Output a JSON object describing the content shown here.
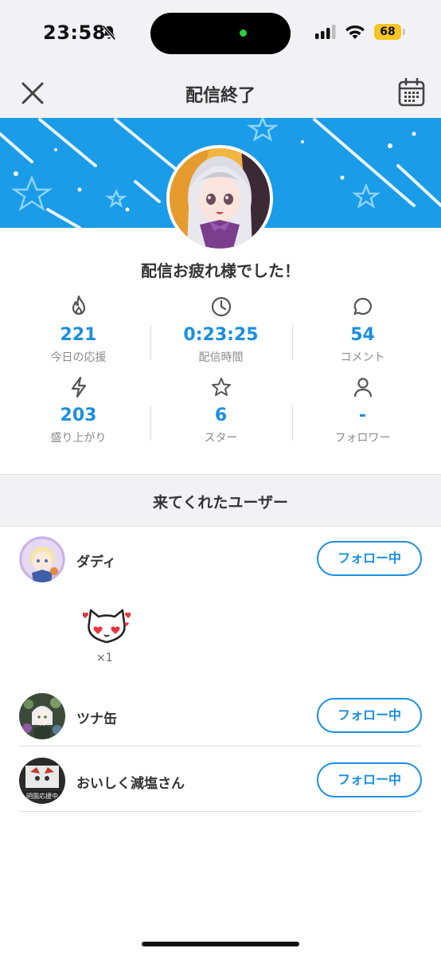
{
  "status_bar": {
    "time": "23:58",
    "battery": "68"
  },
  "nav": {
    "title": "配信終了"
  },
  "thanks_message": "配信お疲れ様でした！",
  "stats": [
    {
      "icon": "flame-icon",
      "value": "221",
      "label": "今日の応援"
    },
    {
      "icon": "clock-icon",
      "value": "0:23:25",
      "label": "配信時間"
    },
    {
      "icon": "comment-icon",
      "value": "54",
      "label": "コメント"
    },
    {
      "icon": "lightning-icon",
      "value": "203",
      "label": "盛り上がり"
    },
    {
      "icon": "star-icon",
      "value": "6",
      "label": "スター"
    },
    {
      "icon": "person-icon",
      "value": "-",
      "label": "フォロワー"
    }
  ],
  "visitors_section": {
    "title": "来てくれたユーザー"
  },
  "users": [
    {
      "name": "ダディ",
      "follow_label": "フォロー中"
    },
    {
      "name": "ツナ缶",
      "follow_label": "フォロー中"
    },
    {
      "name": "おいしく減塩さん",
      "follow_label": "フォロー中"
    }
  ],
  "gift": {
    "count": "×1"
  },
  "avatar_overlay_text": "明園応援中",
  "colors": {
    "accent": "#1a8fe0",
    "banner": "#1a9ce8",
    "battery": "#f5c623"
  }
}
